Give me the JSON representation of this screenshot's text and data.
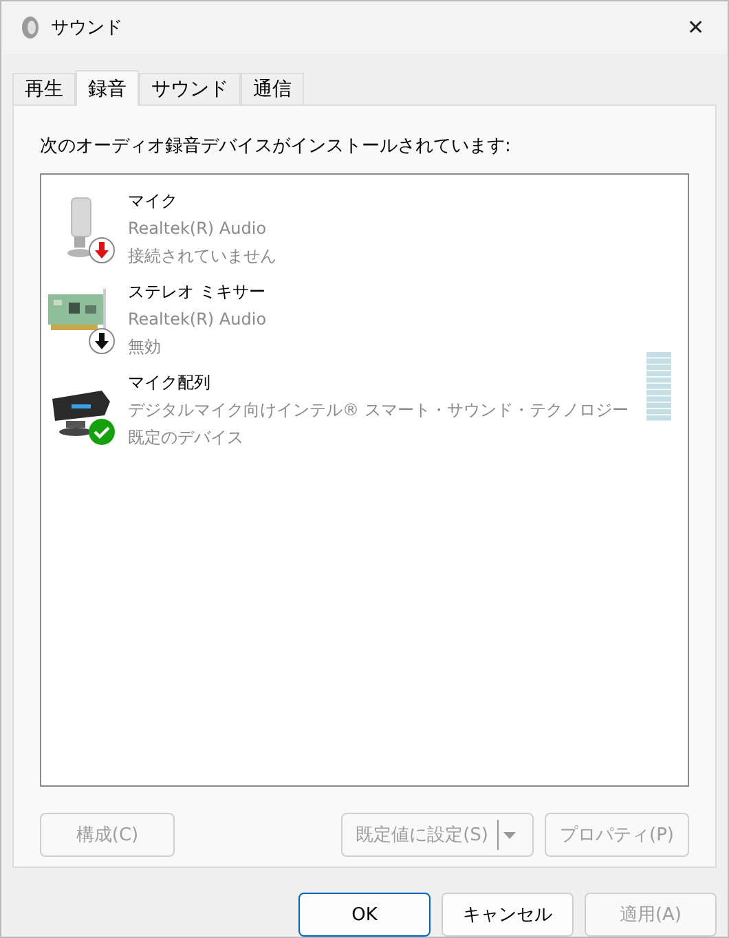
{
  "window": {
    "title": "サウンド",
    "close": "✕"
  },
  "tabs": [
    {
      "label": "再生",
      "selected": false
    },
    {
      "label": "録音",
      "selected": true
    },
    {
      "label": "サウンド",
      "selected": false
    },
    {
      "label": "通信",
      "selected": false
    }
  ],
  "intro": "次のオーディオ録音デバイスがインストールされています:",
  "devices": [
    {
      "kind": "microphone",
      "badge": {
        "kind": "disconnected"
      },
      "name": "マイク",
      "driver": "Realtek(R) Audio",
      "state": "接続されていません"
    },
    {
      "kind": "mixer",
      "badge": {
        "kind": "disabled"
      },
      "name": "ステレオ ミキサー",
      "driver": "Realtek(R) Audio",
      "state": "無効"
    },
    {
      "kind": "array",
      "badge": {
        "kind": "default"
      },
      "name": "マイク配列",
      "driver": "デジタルマイク向けインテル® スマート・サウンド・テクノロジー",
      "state": "既定のデバイス",
      "meter": true
    }
  ],
  "panel_buttons": [
    {
      "label": "構成(C)",
      "disabled": true
    },
    {
      "label": "既定値に設定(S)",
      "disabled": true,
      "split": true
    },
    {
      "label": "プロパティ(P)",
      "disabled": true
    }
  ],
  "dialog_buttons": [
    {
      "label": "OK",
      "disabled": false,
      "default": true
    },
    {
      "label": "キャンセル",
      "disabled": false,
      "default": false
    },
    {
      "label": "適用(A)",
      "disabled": true,
      "default": false
    }
  ]
}
